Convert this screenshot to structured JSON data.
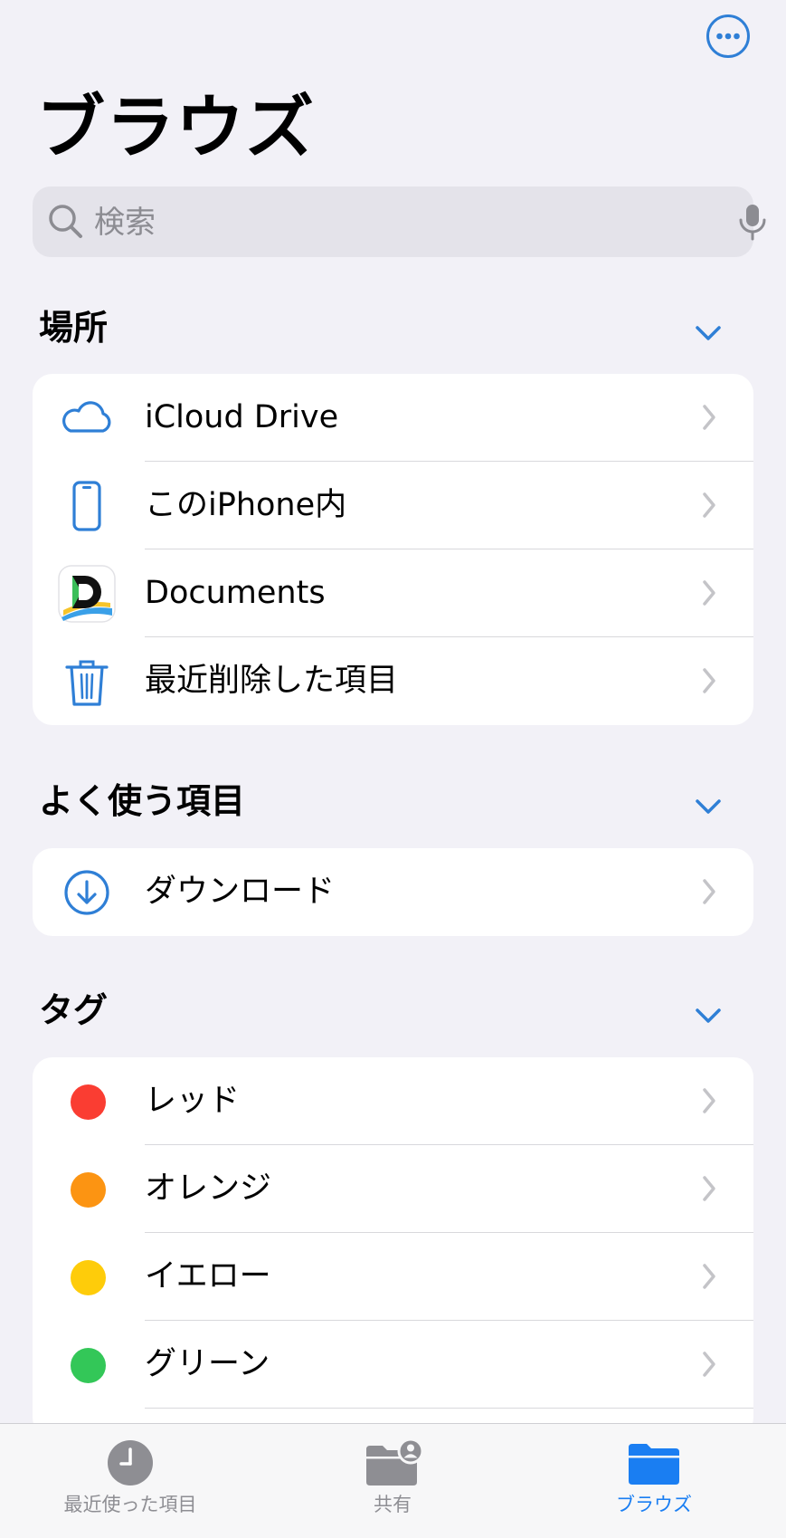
{
  "header": {
    "title": "ブラウズ",
    "more_icon": "ellipsis-circle-icon",
    "accent_color": "#2f7fd6"
  },
  "search": {
    "placeholder": "検索",
    "search_icon": "magnifying-glass-icon",
    "mic_icon": "microphone-icon"
  },
  "locations": {
    "title": "場所",
    "toggle_icon": "chevron-down-icon",
    "items": [
      {
        "label": "iCloud Drive",
        "icon": "cloud-icon"
      },
      {
        "label": "このiPhone内",
        "icon": "iphone-icon"
      },
      {
        "label": "Documents",
        "icon": "documents-app-icon"
      },
      {
        "label": "最近削除した項目",
        "icon": "trash-icon"
      }
    ]
  },
  "favorites": {
    "title": "よく使う項目",
    "toggle_icon": "chevron-down-icon",
    "items": [
      {
        "label": "ダウンロード",
        "icon": "download-circle-icon"
      }
    ]
  },
  "tags": {
    "title": "タグ",
    "toggle_icon": "chevron-down-icon",
    "items": [
      {
        "label": "レッド",
        "color": "#fa3d32"
      },
      {
        "label": "オレンジ",
        "color": "#fc9412"
      },
      {
        "label": "イエロー",
        "color": "#fecc0a"
      },
      {
        "label": "グリーン",
        "color": "#33c758"
      }
    ]
  },
  "tabbar": {
    "tabs": [
      {
        "label": "最近使った項目",
        "icon": "clock-icon",
        "active": false
      },
      {
        "label": "共有",
        "icon": "shared-folder-icon",
        "active": false
      },
      {
        "label": "ブラウズ",
        "icon": "folder-icon",
        "active": true
      }
    ],
    "active_color": "#1a7ef2",
    "inactive_color": "#8e8e93"
  }
}
